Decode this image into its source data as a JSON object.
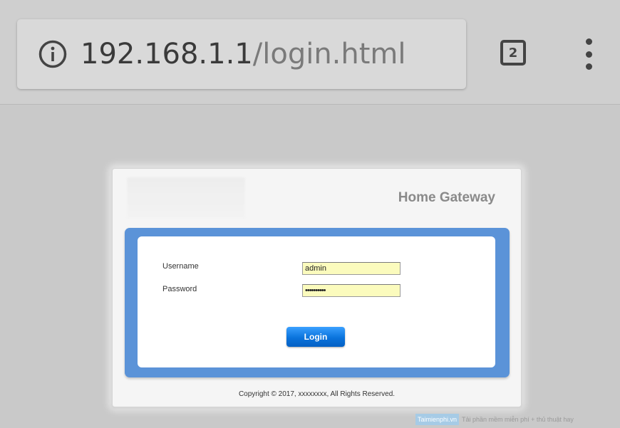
{
  "browser": {
    "url_host": "192.168.1.1",
    "url_path": "/login.html",
    "tab_count": "2"
  },
  "login": {
    "brand_title": "Home Gateway",
    "username_label": "Username",
    "username_value": "admin",
    "password_label": "Password",
    "password_value": "••••••••••",
    "login_button": "Login",
    "copyright": "Copyright © 2017, xxxxxxxx, All Rights Reserved."
  },
  "watermark": {
    "brand": "Taimienphi.vn",
    "tagline": "Tải phần mềm miễn phí + thủ thuật hay"
  },
  "colors": {
    "panel_blue": "#5b93d8",
    "input_yellow": "#fbfbbd",
    "button_blue": "#0a73dc"
  }
}
